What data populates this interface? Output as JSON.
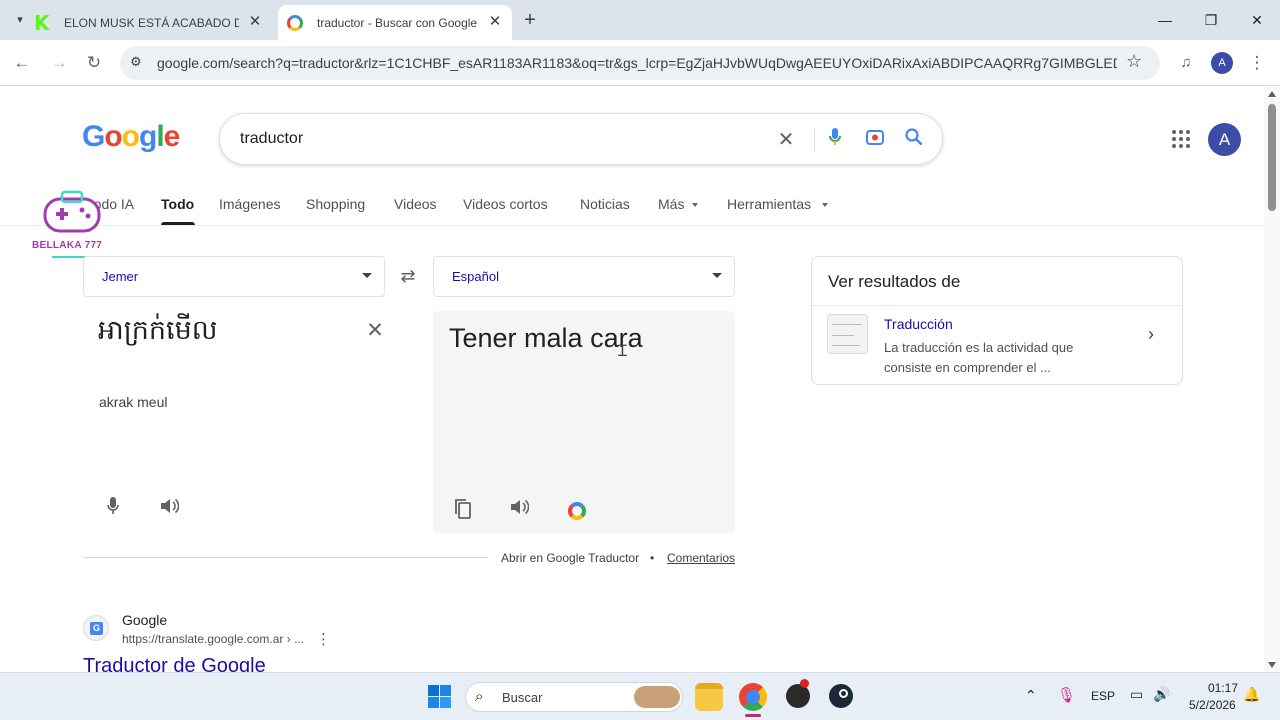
{
  "tabs": [
    {
      "title": "ELON MUSK ESTÁ ACABADO D",
      "active": false
    },
    {
      "title": "traductor - Buscar con Google",
      "active": true
    }
  ],
  "new_tab_symbol": "+",
  "address": "google.com/search?q=traductor&rlz=1C1CHBF_esAR1183AR1183&oq=tr&gs_lcrp=EgZjaHJvbWUqDwgAEEUYOxiDARixAxiABDIPCAAQRRg7GIMBGLEDGI...",
  "profile_initial": "A",
  "logo_text": "Google",
  "search": {
    "query": "traductor"
  },
  "nav_tabs": [
    "Modo IA",
    "Todo",
    "Imágenes",
    "Shopping",
    "Videos",
    "Videos cortos",
    "Noticias",
    "Más",
    "Herramientas"
  ],
  "active_nav_tab": "Todo",
  "overlay_logo_text": "BELLAKA 777",
  "translator": {
    "source_lang": "Jemer",
    "target_lang": "Español",
    "source_text": "អាក្រក់មើល",
    "transliteration": "akrak meul",
    "output_text": "Tener mala cara",
    "open_link": "Abrir en Google Traductor",
    "separator": "•",
    "feedback_link": "Comentarios"
  },
  "side_card": {
    "heading": "Ver resultados de",
    "item_title": "Traducción",
    "item_desc": "La traducción es la actividad que consiste en comprender el ..."
  },
  "result": {
    "site_name": "Google",
    "url": "https://translate.google.com.ar › ...",
    "title": "Traductor de Google"
  },
  "taskbar": {
    "search_placeholder": "Buscar",
    "lang": "ESP",
    "time": "01:17",
    "date": "5/2/2026"
  },
  "colors": {
    "accent": "#1a73e8",
    "link": "#1a0dab",
    "tabstrip": "#dde3ea"
  }
}
